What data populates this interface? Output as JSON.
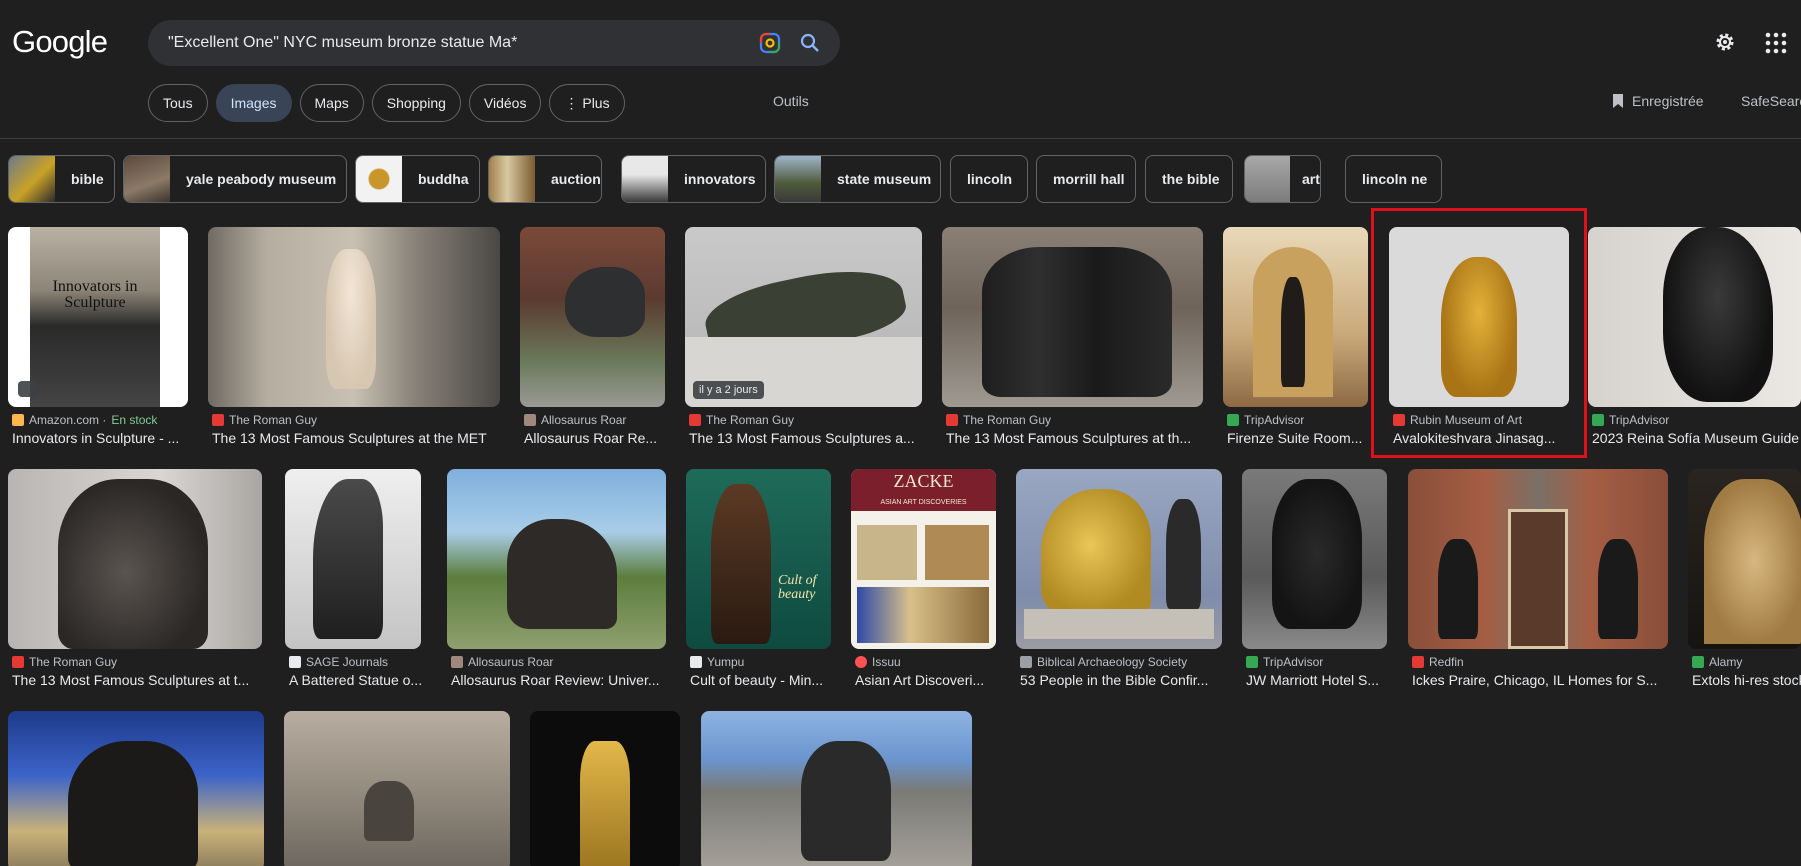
{
  "logo": "Google",
  "search": {
    "query": "\"Excellent One\" NYC museum bronze statue Ma*"
  },
  "tabs": [
    "Tous",
    "Images",
    "Maps",
    "Shopping",
    "Vidéos",
    "⋮ Plus"
  ],
  "tools_label": "Outils",
  "saved_label": "Enregistrée",
  "safe_label": "SafeSearch",
  "chips": [
    "bible",
    "yale peabody museum",
    "buddha",
    "auction",
    "innovators",
    "state museum",
    "lincoln",
    "morrill hall",
    "the bible",
    "art",
    "lincoln ne"
  ],
  "images": [
    {
      "source": "Amazon.com · ",
      "stock": "En stock",
      "title": "Innovators in Sculpture - ...",
      "badge": ""
    },
    {
      "source": "The Roman Guy",
      "title": "The 13 Most Famous Sculptures at the MET",
      "badge": ""
    },
    {
      "source": "Allosaurus Roar",
      "title": "Allosaurus Roar Re...",
      "badge": ""
    },
    {
      "source": "The Roman Guy",
      "title": "The 13 Most Famous Sculptures a...",
      "badge": "il y a 2 jours"
    },
    {
      "source": "The Roman Guy",
      "title": "The 13 Most Famous Sculptures at th...",
      "badge": ""
    },
    {
      "source": "TripAdvisor",
      "title": "Firenze Suite Room...",
      "badge": ""
    },
    {
      "source": "Rubin Museum of Art",
      "title": "Avalokiteshvara Jinasag...",
      "badge": ""
    },
    {
      "source": "TripAdvisor",
      "title": "2023 Reina Sofía Museum Guide",
      "badge": ""
    },
    {
      "source": "The Roman Guy",
      "title": "The 13 Most Famous Sculptures at t...",
      "badge": ""
    },
    {
      "source": "SAGE Journals",
      "title": "A Battered Statue o...",
      "badge": ""
    },
    {
      "source": "Allosaurus Roar",
      "title": "Allosaurus Roar Review: Univer...",
      "badge": ""
    },
    {
      "source": "Yumpu",
      "title": "Cult of beauty - Min...",
      "badge": ""
    },
    {
      "source": "Issuu",
      "title": "Asian Art Discoveri...",
      "badge": ""
    },
    {
      "source": "Biblical Archaeology Society",
      "title": "53 People in the Bible Confir...",
      "badge": ""
    },
    {
      "source": "TripAdvisor",
      "title": "JW Marriott Hotel S...",
      "badge": ""
    },
    {
      "source": "Redfin",
      "title": "Ickes Praire, Chicago, IL Homes for S...",
      "badge": ""
    },
    {
      "source": "Alamy",
      "title": "Extols hi-res stock",
      "badge": ""
    },
    {
      "source": "",
      "title": "",
      "badge": ""
    },
    {
      "source": "",
      "title": "",
      "badge": ""
    },
    {
      "source": "",
      "title": "",
      "badge": ""
    },
    {
      "source": "",
      "title": "",
      "badge": ""
    }
  ],
  "image_texts": {
    "innovators_cover": "Innovators in Sculpture",
    "minerva_caption": "Cult of beauty",
    "zacke_title": "ZACKE",
    "zacke_sub": "ASIAN ART DISCOVERIES"
  },
  "colors": {
    "highlight": "#e0101a",
    "accent_tab": "#394457"
  }
}
